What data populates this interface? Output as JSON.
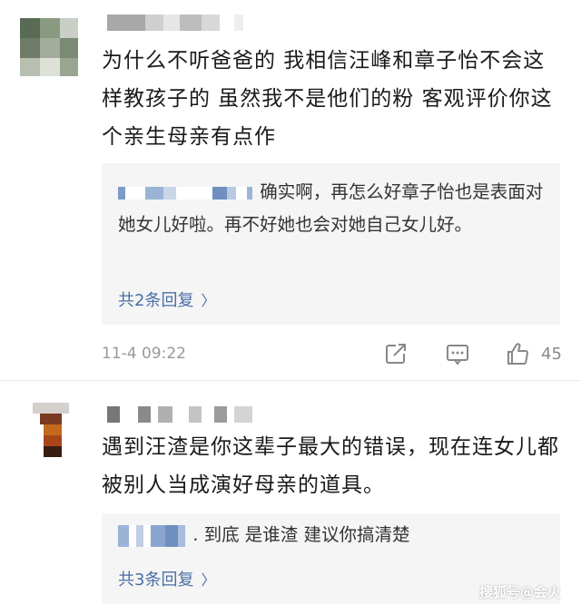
{
  "comments": [
    {
      "text": "为什么不听爸爸的 我相信汪峰和章子怡不会这样教孩子的 虽然我不是他们的粉 客观评价你这个亲生母亲有点作",
      "reply": {
        "text": "确实啊，再怎么好章子怡也是表面对她女儿好啦。再不好她也会对她自己女儿好。",
        "count_label": "共2条回复"
      },
      "timestamp": "11-4 09:22",
      "likes": "45",
      "actions": [
        "share-icon",
        "comment-icon",
        "like-icon"
      ]
    },
    {
      "text": "遇到汪渣是你这辈子最大的错误，现在连女儿都被别人当成演好母亲的道具。",
      "reply": {
        "text": ". 到底 是谁渣 建议你搞清楚",
        "count_label": "共3条回复"
      },
      "chevron": "chevron-right-icon"
    }
  ],
  "watermark": "搜狐号@会火",
  "colors": {
    "link": "#4a6fa5",
    "reply_bg": "#f5f5f5",
    "meta_gray": "#999999"
  }
}
